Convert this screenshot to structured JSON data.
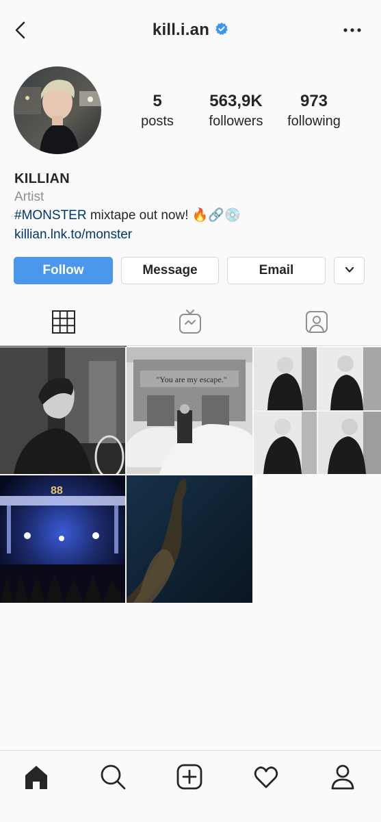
{
  "header": {
    "username": "kill.i.an",
    "verified_icon": "verified-badge-icon",
    "back_icon": "back-chevron-icon",
    "more_icon": "more-dots-icon"
  },
  "profile": {
    "stats": [
      {
        "value": "5",
        "label": "posts"
      },
      {
        "value": "563,9K",
        "label": "followers"
      },
      {
        "value": "973",
        "label": "following"
      }
    ],
    "name": "KILLIAN",
    "category": "Artist",
    "bio_hashtag": "#MONSTER",
    "bio_text": " mixtape out now! 🔥🔗💿",
    "link": "killian.lnk.to/monster"
  },
  "actions": {
    "follow": "Follow",
    "message": "Message",
    "email": "Email",
    "more_icon": "chevron-down-icon"
  },
  "tabs": [
    {
      "name": "grid",
      "icon": "grid-icon",
      "active": true
    },
    {
      "name": "igtv",
      "icon": "igtv-icon",
      "active": false
    },
    {
      "name": "tagged",
      "icon": "tagged-user-icon",
      "active": false
    }
  ],
  "posts": {
    "post_2_sign_text": "\"You are my escape.\"",
    "post_4_sign_text": "88"
  },
  "bottom_nav": [
    {
      "name": "home",
      "icon": "home-icon",
      "active": true
    },
    {
      "name": "search",
      "icon": "search-icon",
      "active": false
    },
    {
      "name": "new-post",
      "icon": "add-post-icon",
      "active": false
    },
    {
      "name": "activity",
      "icon": "heart-icon",
      "active": false
    },
    {
      "name": "profile",
      "icon": "profile-icon",
      "active": false
    }
  ],
  "colors": {
    "accent": "#4a97ec",
    "verified": "#3897f0",
    "link": "#00376b",
    "muted": "#8e8e8e"
  }
}
